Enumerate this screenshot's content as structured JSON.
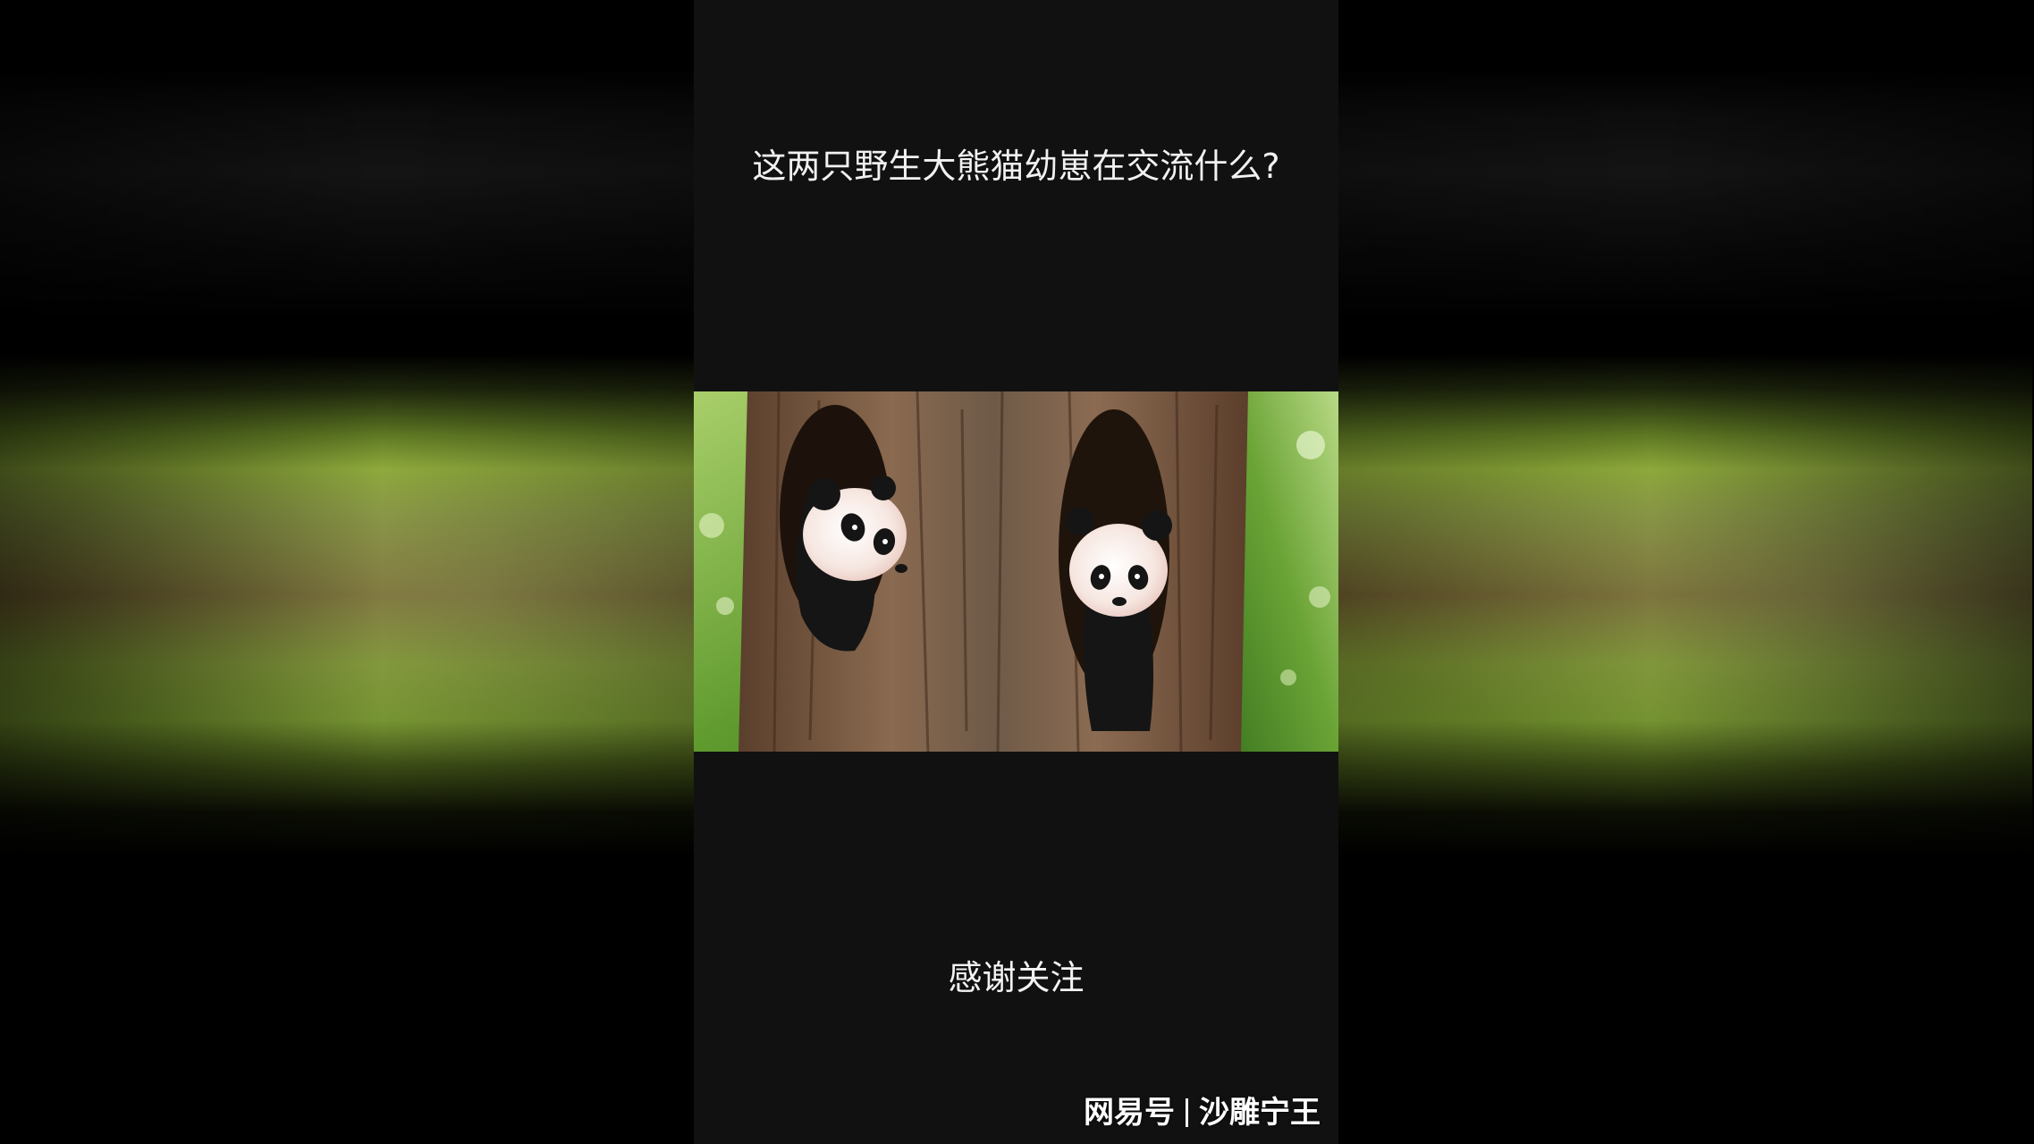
{
  "video": {
    "caption": "这两只野生大熊猫幼崽在交流什么?",
    "subtitle": "感谢关注",
    "image_description": "two giant panda cubs peeking out of holes in a tree trunk"
  },
  "watermark": {
    "platform": "网易号",
    "author": "沙雕宁王"
  },
  "colors": {
    "phone_bg": "#111111",
    "text": "#f1f1f1",
    "foliage": "#6f9a34",
    "bark": "#6b4a33"
  }
}
